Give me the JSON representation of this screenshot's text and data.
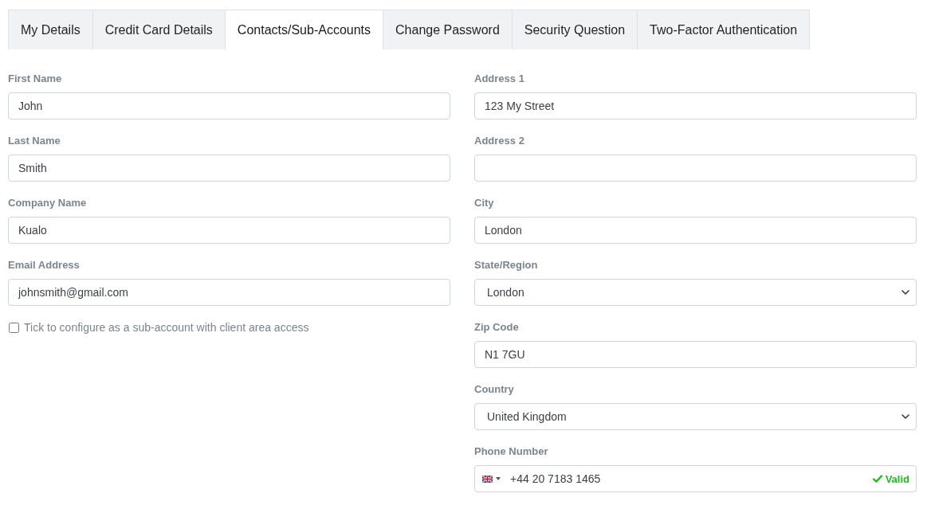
{
  "tabs": [
    {
      "label": "My Details",
      "selected": false
    },
    {
      "label": "Credit Card Details",
      "selected": false
    },
    {
      "label": "Contacts/Sub-Accounts",
      "selected": true
    },
    {
      "label": "Change Password",
      "selected": false
    },
    {
      "label": "Security Question",
      "selected": false
    },
    {
      "label": "Two-Factor Authentication",
      "selected": false
    }
  ],
  "left_fields": [
    {
      "label": "First Name",
      "kind": "text",
      "value": "John"
    },
    {
      "label": "Last Name",
      "kind": "text",
      "value": "Smith"
    },
    {
      "label": "Company Name",
      "kind": "text",
      "value": "Kualo"
    },
    {
      "label": "Email Address",
      "kind": "text",
      "value": "johnsmith@gmail.com"
    }
  ],
  "subaccount_checkbox": {
    "label": "Tick to configure as a sub-account with client area access",
    "checked": false
  },
  "right_fields": [
    {
      "label": "Address 1",
      "kind": "text",
      "value": "123 My Street"
    },
    {
      "label": "Address 2",
      "kind": "text"
    },
    {
      "label": "City",
      "kind": "text",
      "value": "London"
    },
    {
      "label": "State/Region",
      "kind": "select",
      "value": "London"
    },
    {
      "label": "Zip Code",
      "kind": "text",
      "value": "N1 7GU"
    },
    {
      "label": "Country",
      "kind": "select",
      "value": "United Kingdom"
    },
    {
      "label": "Phone Number",
      "kind": "phone",
      "value": "+44 20 7183 1465",
      "validation": {
        "text": "Valid",
        "valid": true
      }
    }
  ]
}
